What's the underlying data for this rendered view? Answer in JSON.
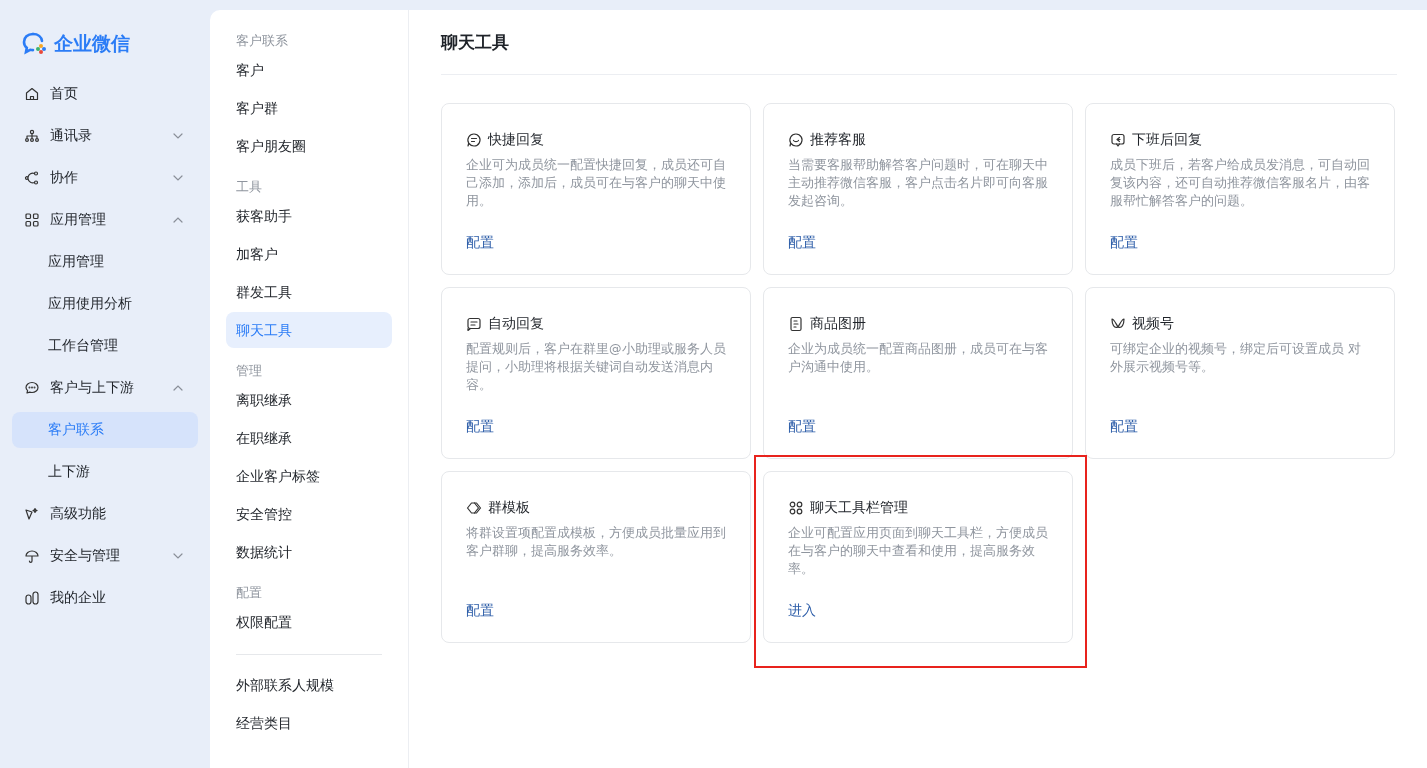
{
  "logo": {
    "text": "企业微信"
  },
  "sidebar": {
    "items": [
      {
        "kind": "link",
        "label": "首页",
        "selected": false
      },
      {
        "kind": "group",
        "label": "通讯录",
        "expanded": false
      },
      {
        "kind": "group",
        "label": "协作",
        "expanded": false
      },
      {
        "kind": "group",
        "label": "应用管理",
        "expanded": true,
        "children": [
          {
            "label": "应用管理",
            "selected": false
          },
          {
            "label": "应用使用分析",
            "selected": false
          },
          {
            "label": "工作台管理",
            "selected": false
          }
        ]
      },
      {
        "kind": "group",
        "label": "客户与上下游",
        "expanded": true,
        "children": [
          {
            "label": "客户联系",
            "selected": true
          },
          {
            "label": "上下游",
            "selected": false
          }
        ]
      },
      {
        "kind": "link",
        "label": "高级功能",
        "selected": false
      },
      {
        "kind": "group",
        "label": "安全与管理",
        "expanded": false
      },
      {
        "kind": "link",
        "label": "我的企业",
        "selected": false
      }
    ]
  },
  "subnav": {
    "sections": [
      {
        "heading": "客户联系",
        "items": [
          {
            "label": "客户",
            "selected": false
          },
          {
            "label": "客户群",
            "selected": false
          },
          {
            "label": "客户朋友圈",
            "selected": false
          }
        ]
      },
      {
        "heading": "工具",
        "items": [
          {
            "label": "获客助手",
            "selected": false
          },
          {
            "label": "加客户",
            "selected": false
          },
          {
            "label": "群发工具",
            "selected": false
          },
          {
            "label": "聊天工具",
            "selected": true
          }
        ]
      },
      {
        "heading": "管理",
        "items": [
          {
            "label": "离职继承",
            "selected": false
          },
          {
            "label": "在职继承",
            "selected": false
          },
          {
            "label": "企业客户标签",
            "selected": false
          },
          {
            "label": "安全管控",
            "selected": false
          },
          {
            "label": "数据统计",
            "selected": false
          }
        ]
      },
      {
        "heading": "配置",
        "items": [
          {
            "label": "权限配置",
            "selected": false
          }
        ]
      },
      {
        "items": [
          {
            "label": "外部联系人规模",
            "selected": false
          },
          {
            "label": "经营类目",
            "selected": false
          }
        ]
      }
    ]
  },
  "page": {
    "title": "聊天工具"
  },
  "cards": [
    {
      "title": "快捷回复",
      "description": "企业可为成员统一配置快捷回复，成员还可自己添加，添加后，成员可在与客户的聊天中使用。",
      "action": "配置",
      "highlighted": false
    },
    {
      "title": "推荐客服",
      "description": "当需要客服帮助解答客户问题时，可在聊天中主动推荐微信客服，客户点击名片即可向客服发起咨询。",
      "action": "配置",
      "highlighted": false
    },
    {
      "title": "下班后回复",
      "description": "成员下班后，若客户给成员发消息，可自动回复该内容，还可自动推荐微信客服名片，由客服帮忙解答客户的问题。",
      "action": "配置",
      "highlighted": false
    },
    {
      "title": "自动回复",
      "description": "配置规则后，客户在群里@小助理或服务人员提问，小助理将根据关键词自动发送消息内容。",
      "action": "配置",
      "highlighted": false
    },
    {
      "title": "商品图册",
      "description": "企业为成员统一配置商品图册，成员可在与客户沟通中使用。",
      "action": "配置",
      "highlighted": false
    },
    {
      "title": "视频号",
      "description": "可绑定企业的视频号，绑定后可设置成员 对外展示视频号等。",
      "action": "配置",
      "highlighted": false
    },
    {
      "title": "群模板",
      "description": "将群设置项配置成模板，方便成员批量应用到客户群聊，提高服务效率。",
      "action": "配置",
      "highlighted": false
    },
    {
      "title": "聊天工具栏管理",
      "description": "企业可配置应用页面到聊天工具栏，方便成员在与客户的聊天中查看和使用，提高服务效率。",
      "action": "进入",
      "highlighted": true
    }
  ]
}
